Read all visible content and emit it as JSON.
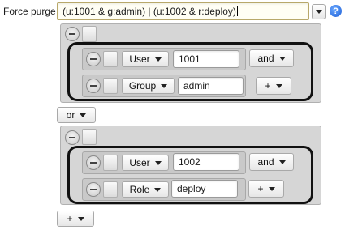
{
  "title_label": "Force purge",
  "expression": "(u:1001 & g:admin) | (u:1002 & r:deploy)",
  "help_glyph": "?",
  "groups": [
    {
      "rows": [
        {
          "type": "User",
          "value": "1001",
          "connector": "and"
        },
        {
          "type": "Group",
          "value": "admin",
          "connector": "+"
        }
      ]
    },
    {
      "rows": [
        {
          "type": "User",
          "value": "1002",
          "connector": "and"
        },
        {
          "type": "Role",
          "value": "deploy",
          "connector": "+"
        }
      ]
    }
  ],
  "between_connector": "or",
  "add_group_label": "+"
}
